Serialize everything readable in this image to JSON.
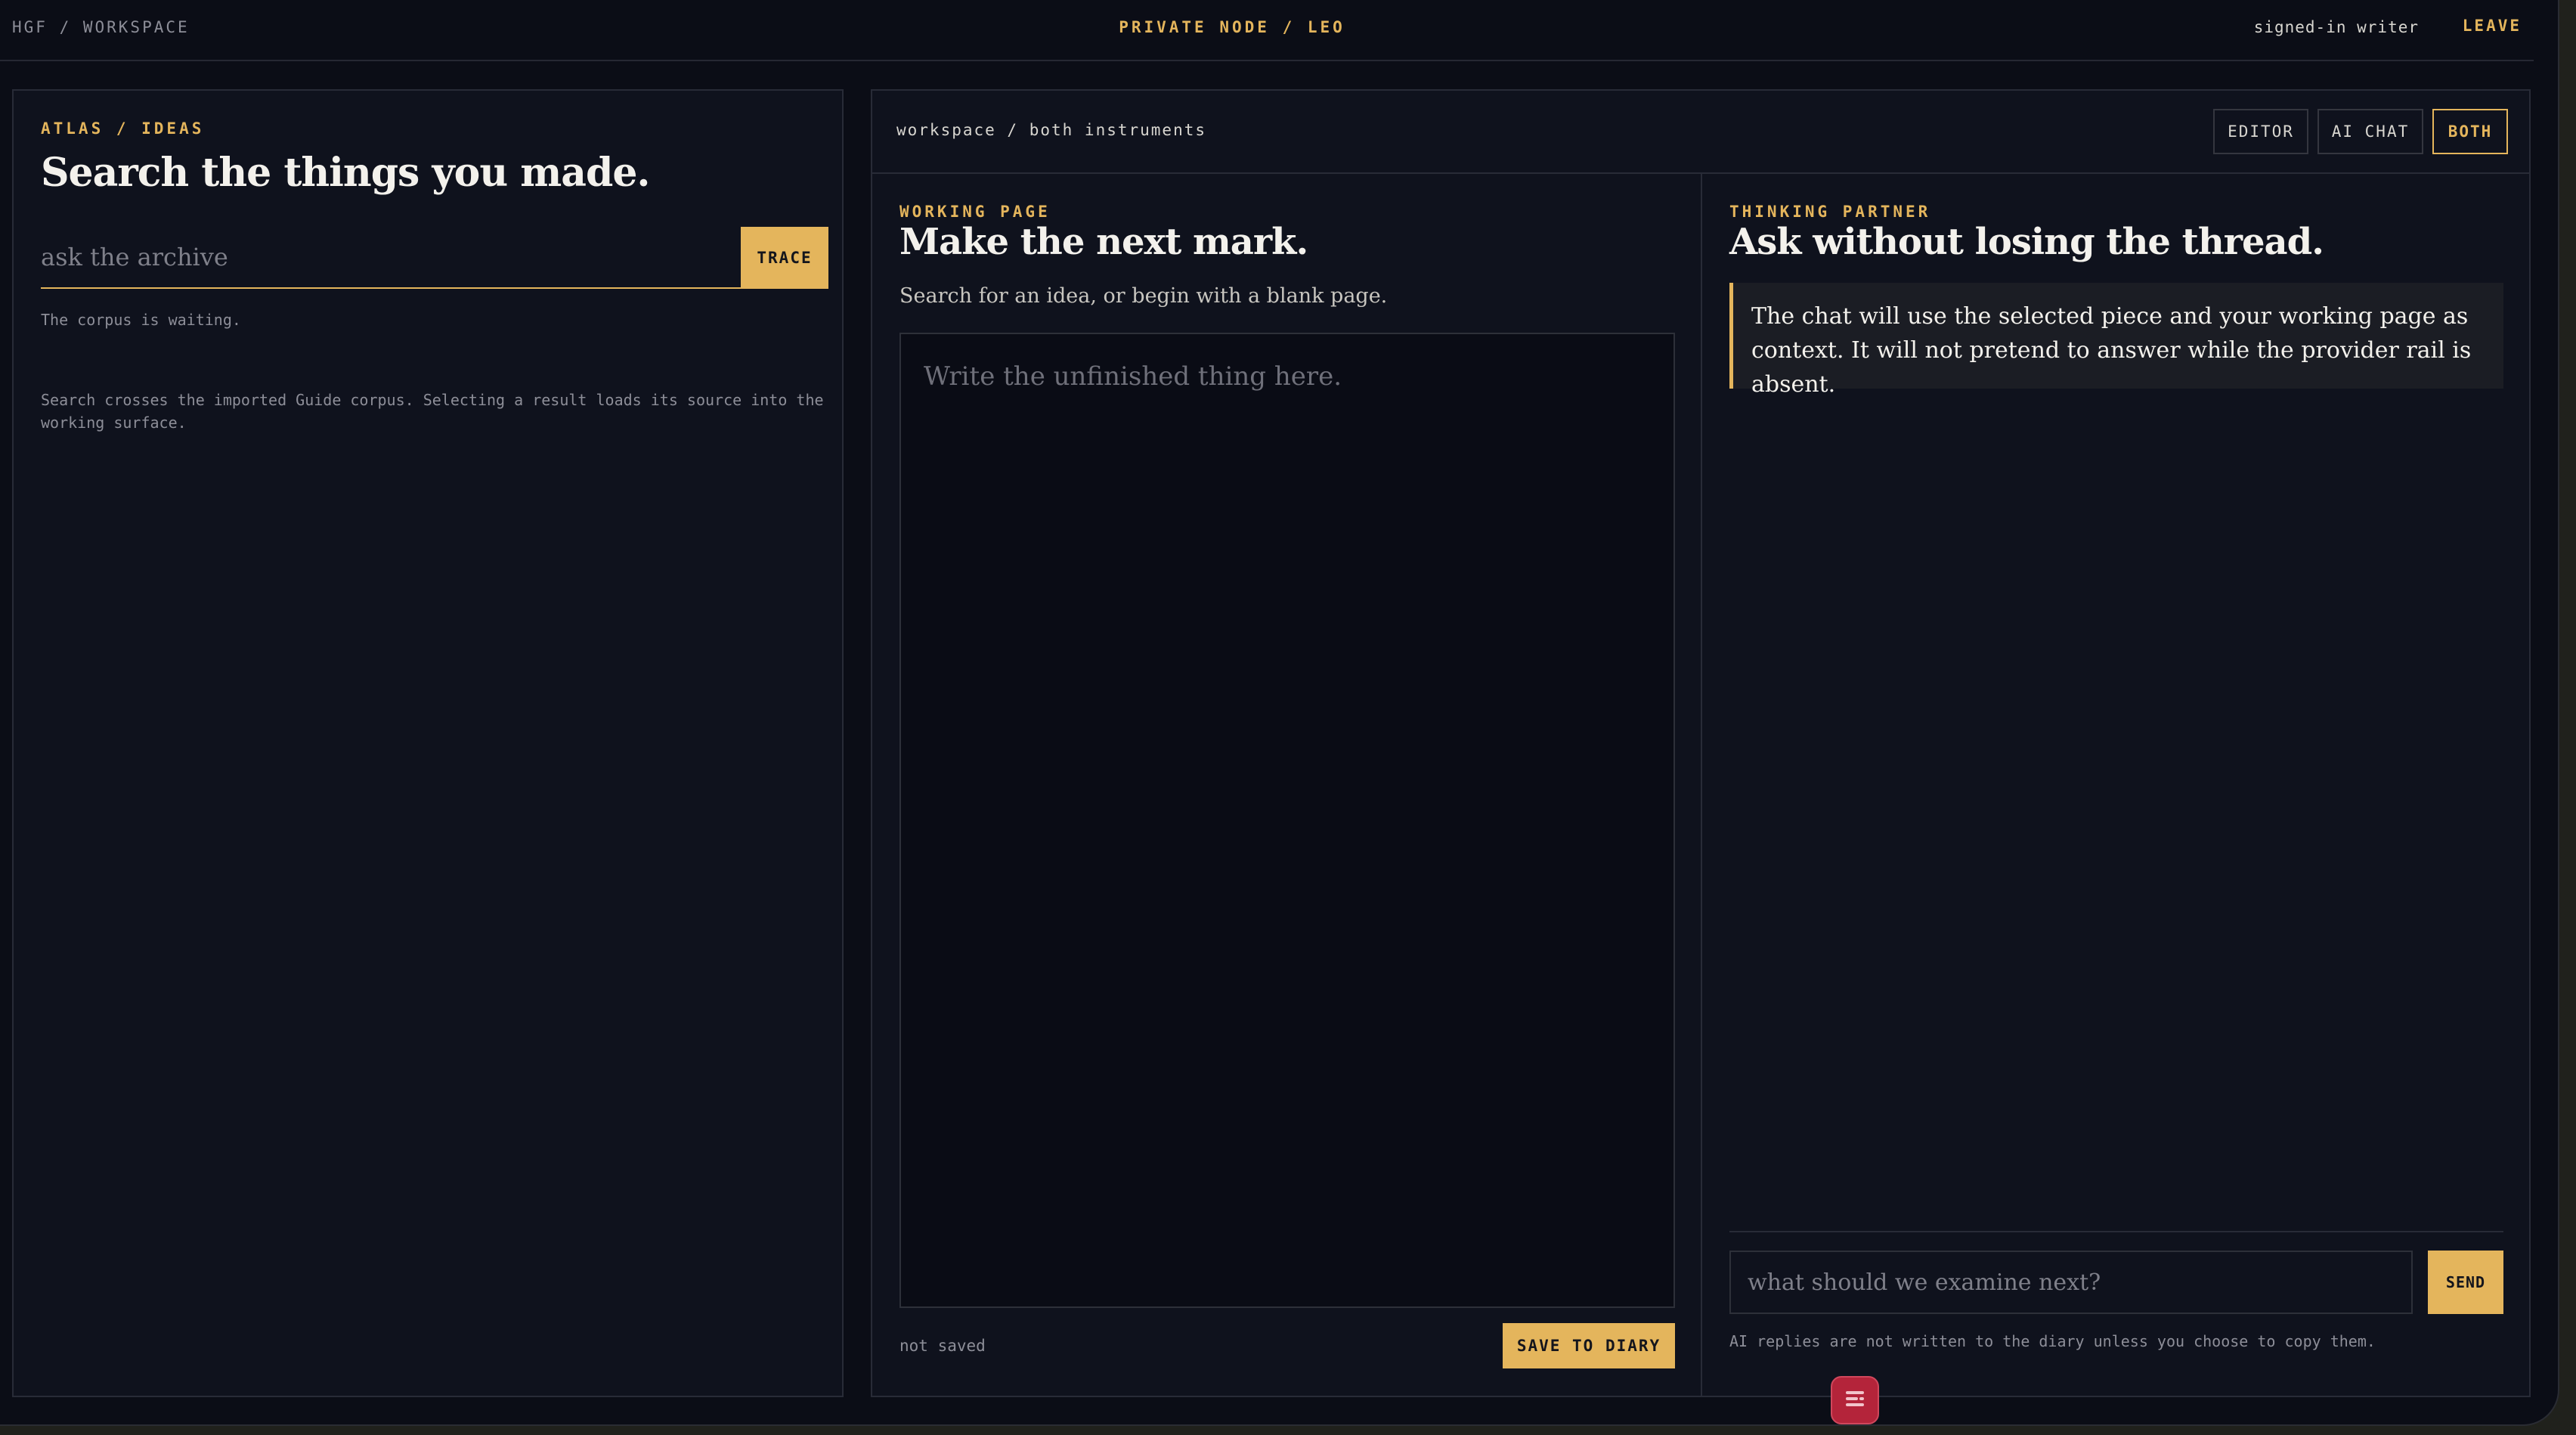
{
  "topbar": {
    "breadcrumb": "HGF / WORKSPACE",
    "node": "PRIVATE NODE / LEO",
    "user": "signed-in writer",
    "leave": "LEAVE"
  },
  "atlas": {
    "eyebrow": "ATLAS / IDEAS",
    "title": "Search the things you made.",
    "search_placeholder": "ask the archive",
    "search_value": "",
    "trace_label": "TRACE",
    "status": "The corpus is waiting.",
    "description": "Search crosses the imported Guide corpus. Selecting a result loads its source into the working surface."
  },
  "workspace": {
    "breadcrumb": "workspace / both instruments",
    "modes": [
      "EDITOR",
      "AI CHAT",
      "BOTH"
    ],
    "active_mode": "BOTH"
  },
  "editor": {
    "eyebrow": "WORKING PAGE",
    "title": "Make the next mark.",
    "subtitle": "Search for an idea, or begin with a blank page.",
    "placeholder": "Write the unfinished thing here.",
    "value": "",
    "save_status": "not saved",
    "save_label": "SAVE TO DIARY"
  },
  "chat": {
    "eyebrow": "THINKING PARTNER",
    "title": "Ask without losing the thread.",
    "context_note": "The chat will use the selected piece and your working page as context. It will not pretend to answer while the provider rail is absent.",
    "input_placeholder": "what should we examine next?",
    "input_value": "",
    "send_label": "SEND",
    "footnote": "AI replies are not written to the diary unless you choose to copy them."
  },
  "colors": {
    "accent": "#e4b55c",
    "background": "#0b0d16",
    "panel": "#0f121d",
    "badge": "#b4243a"
  },
  "icons": {
    "floating_badge": "menu-icon"
  }
}
